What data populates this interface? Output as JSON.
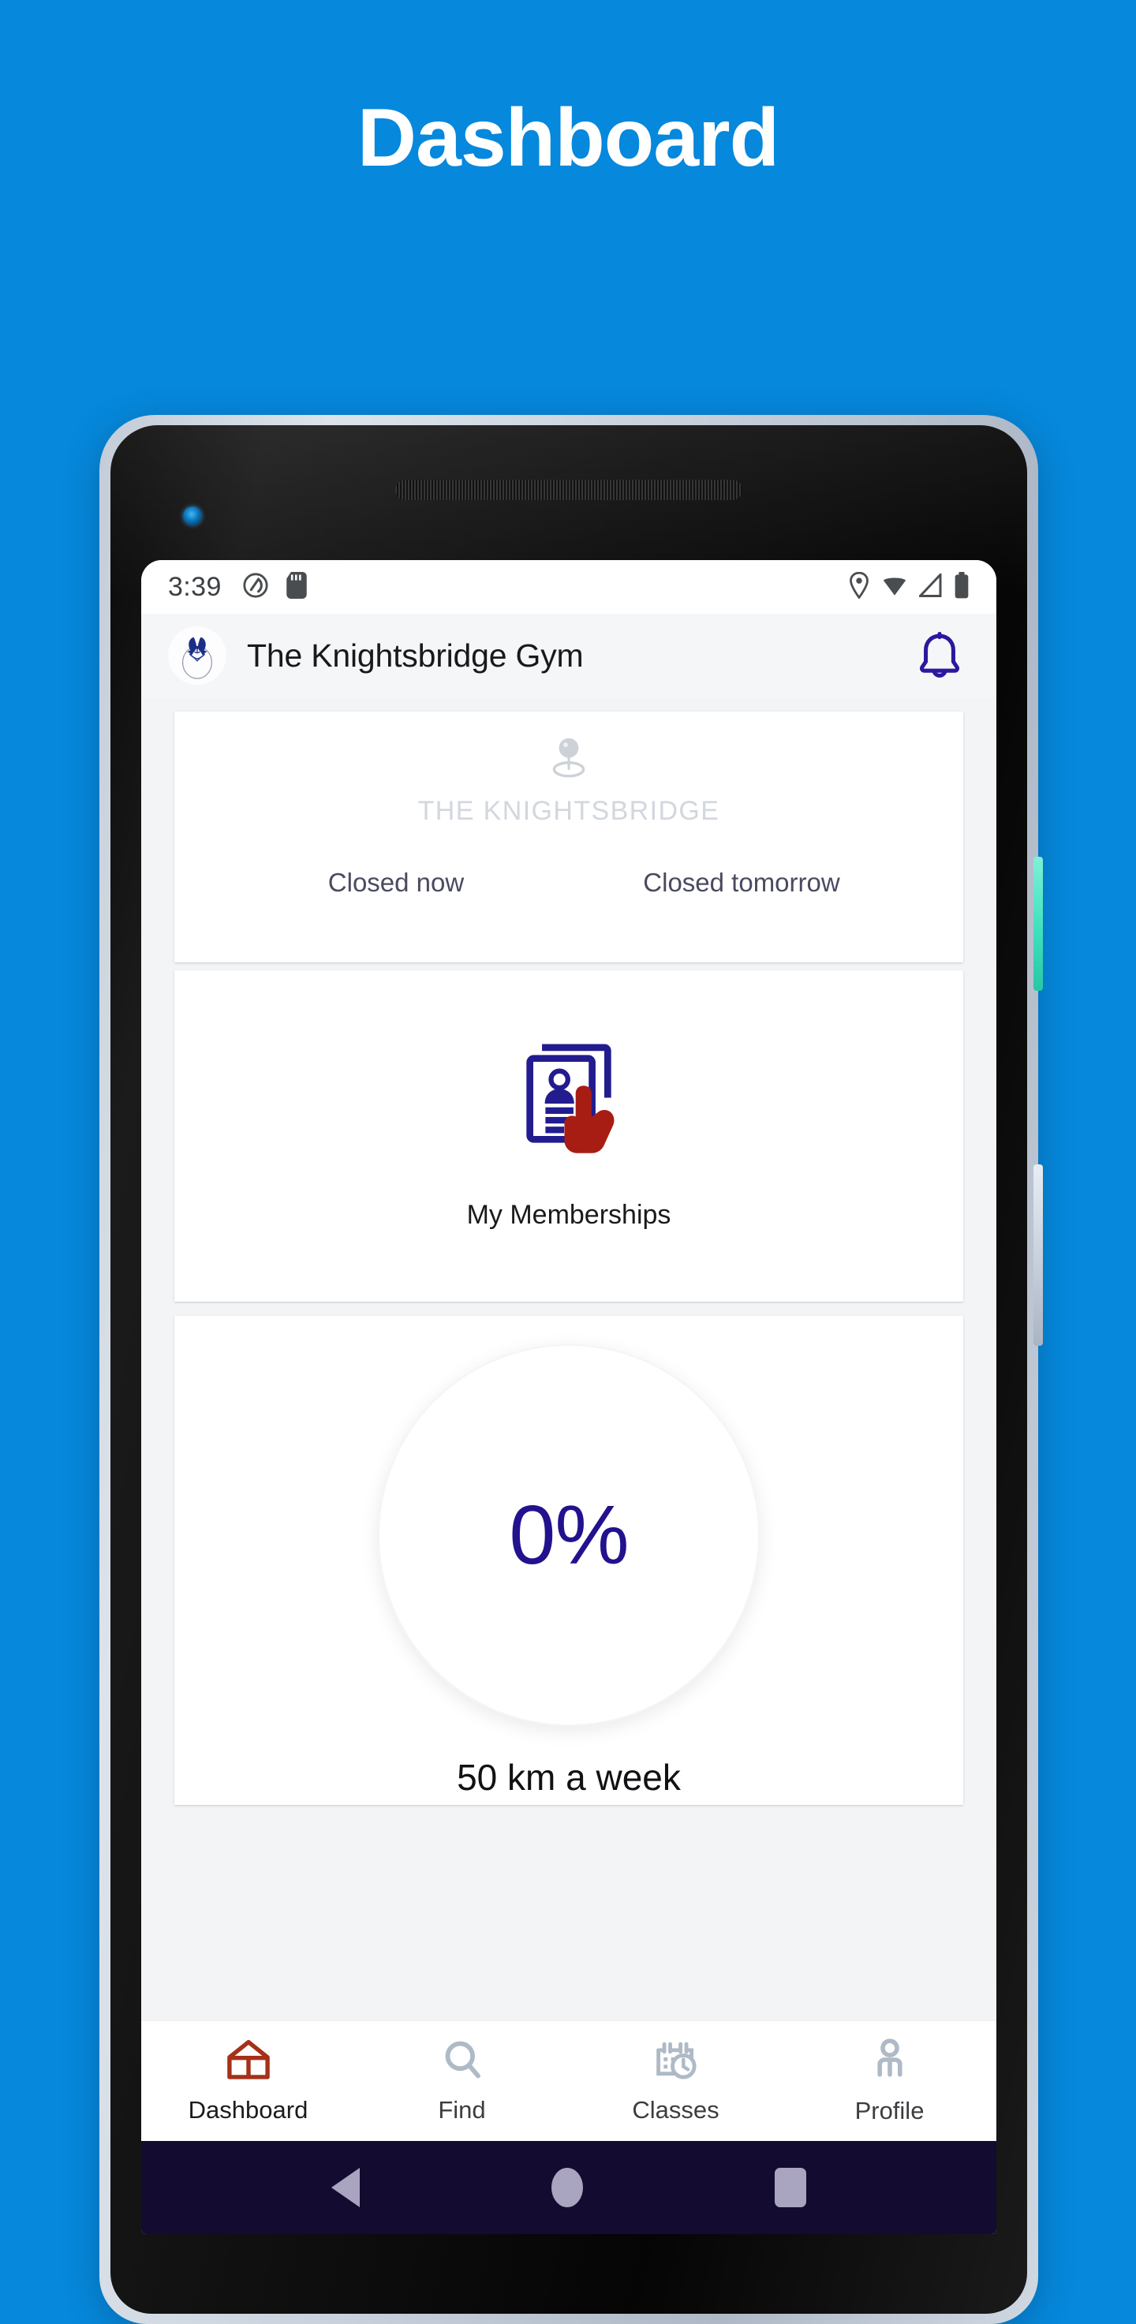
{
  "promo": {
    "title": "Dashboard",
    "background_color": "#0688dc"
  },
  "device": {
    "frame_color": "#c8d1dc",
    "bezel_color": "#0d0d0d",
    "power_button_color": "#3fe0bd",
    "volume_button_color": "#c3ccd8"
  },
  "status_bar": {
    "time": "3:39",
    "left_icons": [
      "android-auto-icon",
      "sd-card-icon"
    ],
    "right_icons": [
      "location-icon",
      "wifi-icon",
      "cell-signal-icon",
      "battery-icon"
    ],
    "icon_color": "#4a4d50"
  },
  "app_bar": {
    "logo_icon": "knightsbridge-crest-logo",
    "title": "The Knightsbridge Gym",
    "notification_icon": "bell-icon",
    "notification_icon_color": "#2a189e",
    "background_color": "#f5f6f8"
  },
  "cards": {
    "gym": {
      "placeholder_icon": "map-pin-icon",
      "placeholder_icon_color": "#cdd2d9",
      "gym_name": "THE KNIGHTSBRIDGE",
      "status_now": "Closed now",
      "status_tomorrow": "Closed tomorrow"
    },
    "memberships": {
      "icon": "membership-card-tap-icon",
      "icon_primary_color": "#221c8f",
      "icon_accent_color": "#a81d13",
      "label": "My Memberships"
    },
    "goal": {
      "icon": "progress-ring",
      "percent": "0%",
      "percent_color": "#22128e",
      "subtitle": "50 km a week"
    }
  },
  "bottom_nav": {
    "items": [
      {
        "label": "Dashboard",
        "icon": "home-icon",
        "color": "#a63019",
        "active": true
      },
      {
        "label": "Find",
        "icon": "search-icon",
        "color": "#aebac6",
        "active": false
      },
      {
        "label": "Classes",
        "icon": "calendar-clock-icon",
        "color": "#aebac6",
        "active": false
      },
      {
        "label": "Profile",
        "icon": "person-icon",
        "color": "#aebac6",
        "active": false
      }
    ]
  },
  "android_nav": {
    "background_color": "#140b30",
    "icon_color": "#a9a5c0",
    "buttons": [
      "back-icon",
      "home-icon",
      "recents-icon"
    ]
  }
}
